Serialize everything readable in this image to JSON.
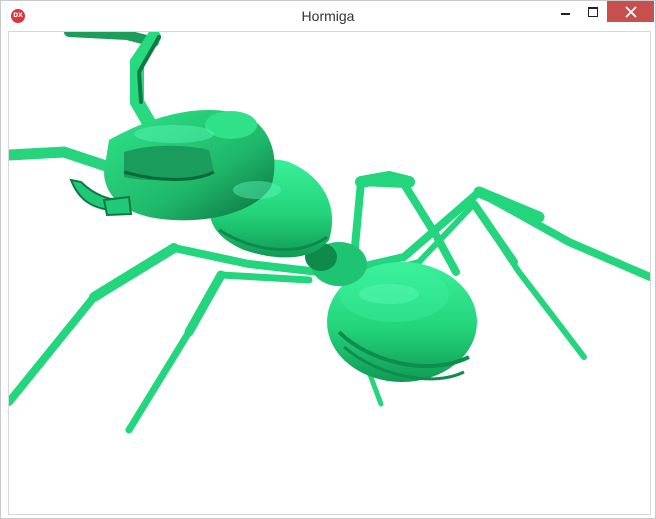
{
  "window": {
    "title": "Hormiga",
    "icon_label": "DX",
    "icon_name": "dx-app-icon",
    "controls": [
      "minimize-icon",
      "maximize-icon",
      "close-icon"
    ]
  },
  "colors": {
    "ant_green": "#2fe083",
    "ant_shadow": "#0f7a44",
    "close_red": "#c7504f"
  }
}
